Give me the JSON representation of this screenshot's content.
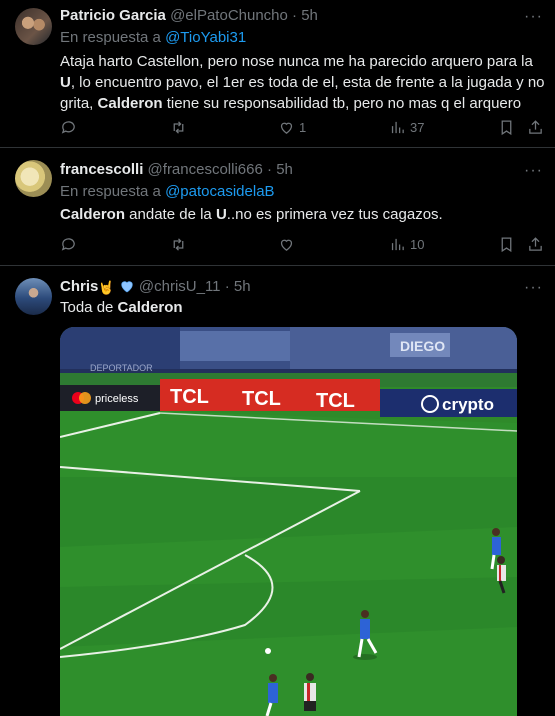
{
  "tweets": [
    {
      "name": "Patricio Garcia",
      "handle": "@elPatoChuncho",
      "dot": "·",
      "time": "5h",
      "reply_prefix": "En respuesta a",
      "reply_mention": "@TioYabi31",
      "text_parts": [
        "Ataja harto Castellon, pero nose nunca me ha parecido arquero para la ",
        "U",
        ", lo encuentro pavo, el 1er es toda de el, esta de frente a la jugada y no grita, ",
        "Calderon",
        " tiene su responsabilidad tb, pero no mas q el arquero"
      ],
      "likes": "1",
      "views": "37"
    },
    {
      "name": "francescolli",
      "handle": "@francescolli666",
      "dot": "·",
      "time": "5h",
      "reply_prefix": "En respuesta a",
      "reply_mention": "@patocasidelaB",
      "text_parts": [
        "Calderon",
        " andate de la ",
        "U",
        "..no es primera vez tus cagazos."
      ],
      "likes": "",
      "views": "10"
    },
    {
      "name": "Chris",
      "emoji": "🤘",
      "handle": "@chrisU_11",
      "dot": "·",
      "time": "5h",
      "text_parts": [
        "Toda de ",
        "Calderon"
      ],
      "media": {
        "watermark": "DEPORTADOR",
        "ads": [
          "priceless",
          "TCL",
          "TCL",
          "TCL",
          "crypto"
        ],
        "banner_top": "DIEGO"
      }
    }
  ],
  "more_icon": "···",
  "colors": {
    "background": "#000000",
    "text": "#e7e9ea",
    "secondary": "#71767b",
    "accent": "#1d9bf0",
    "divider": "#2f3336",
    "verified": "#1d9bf0"
  }
}
